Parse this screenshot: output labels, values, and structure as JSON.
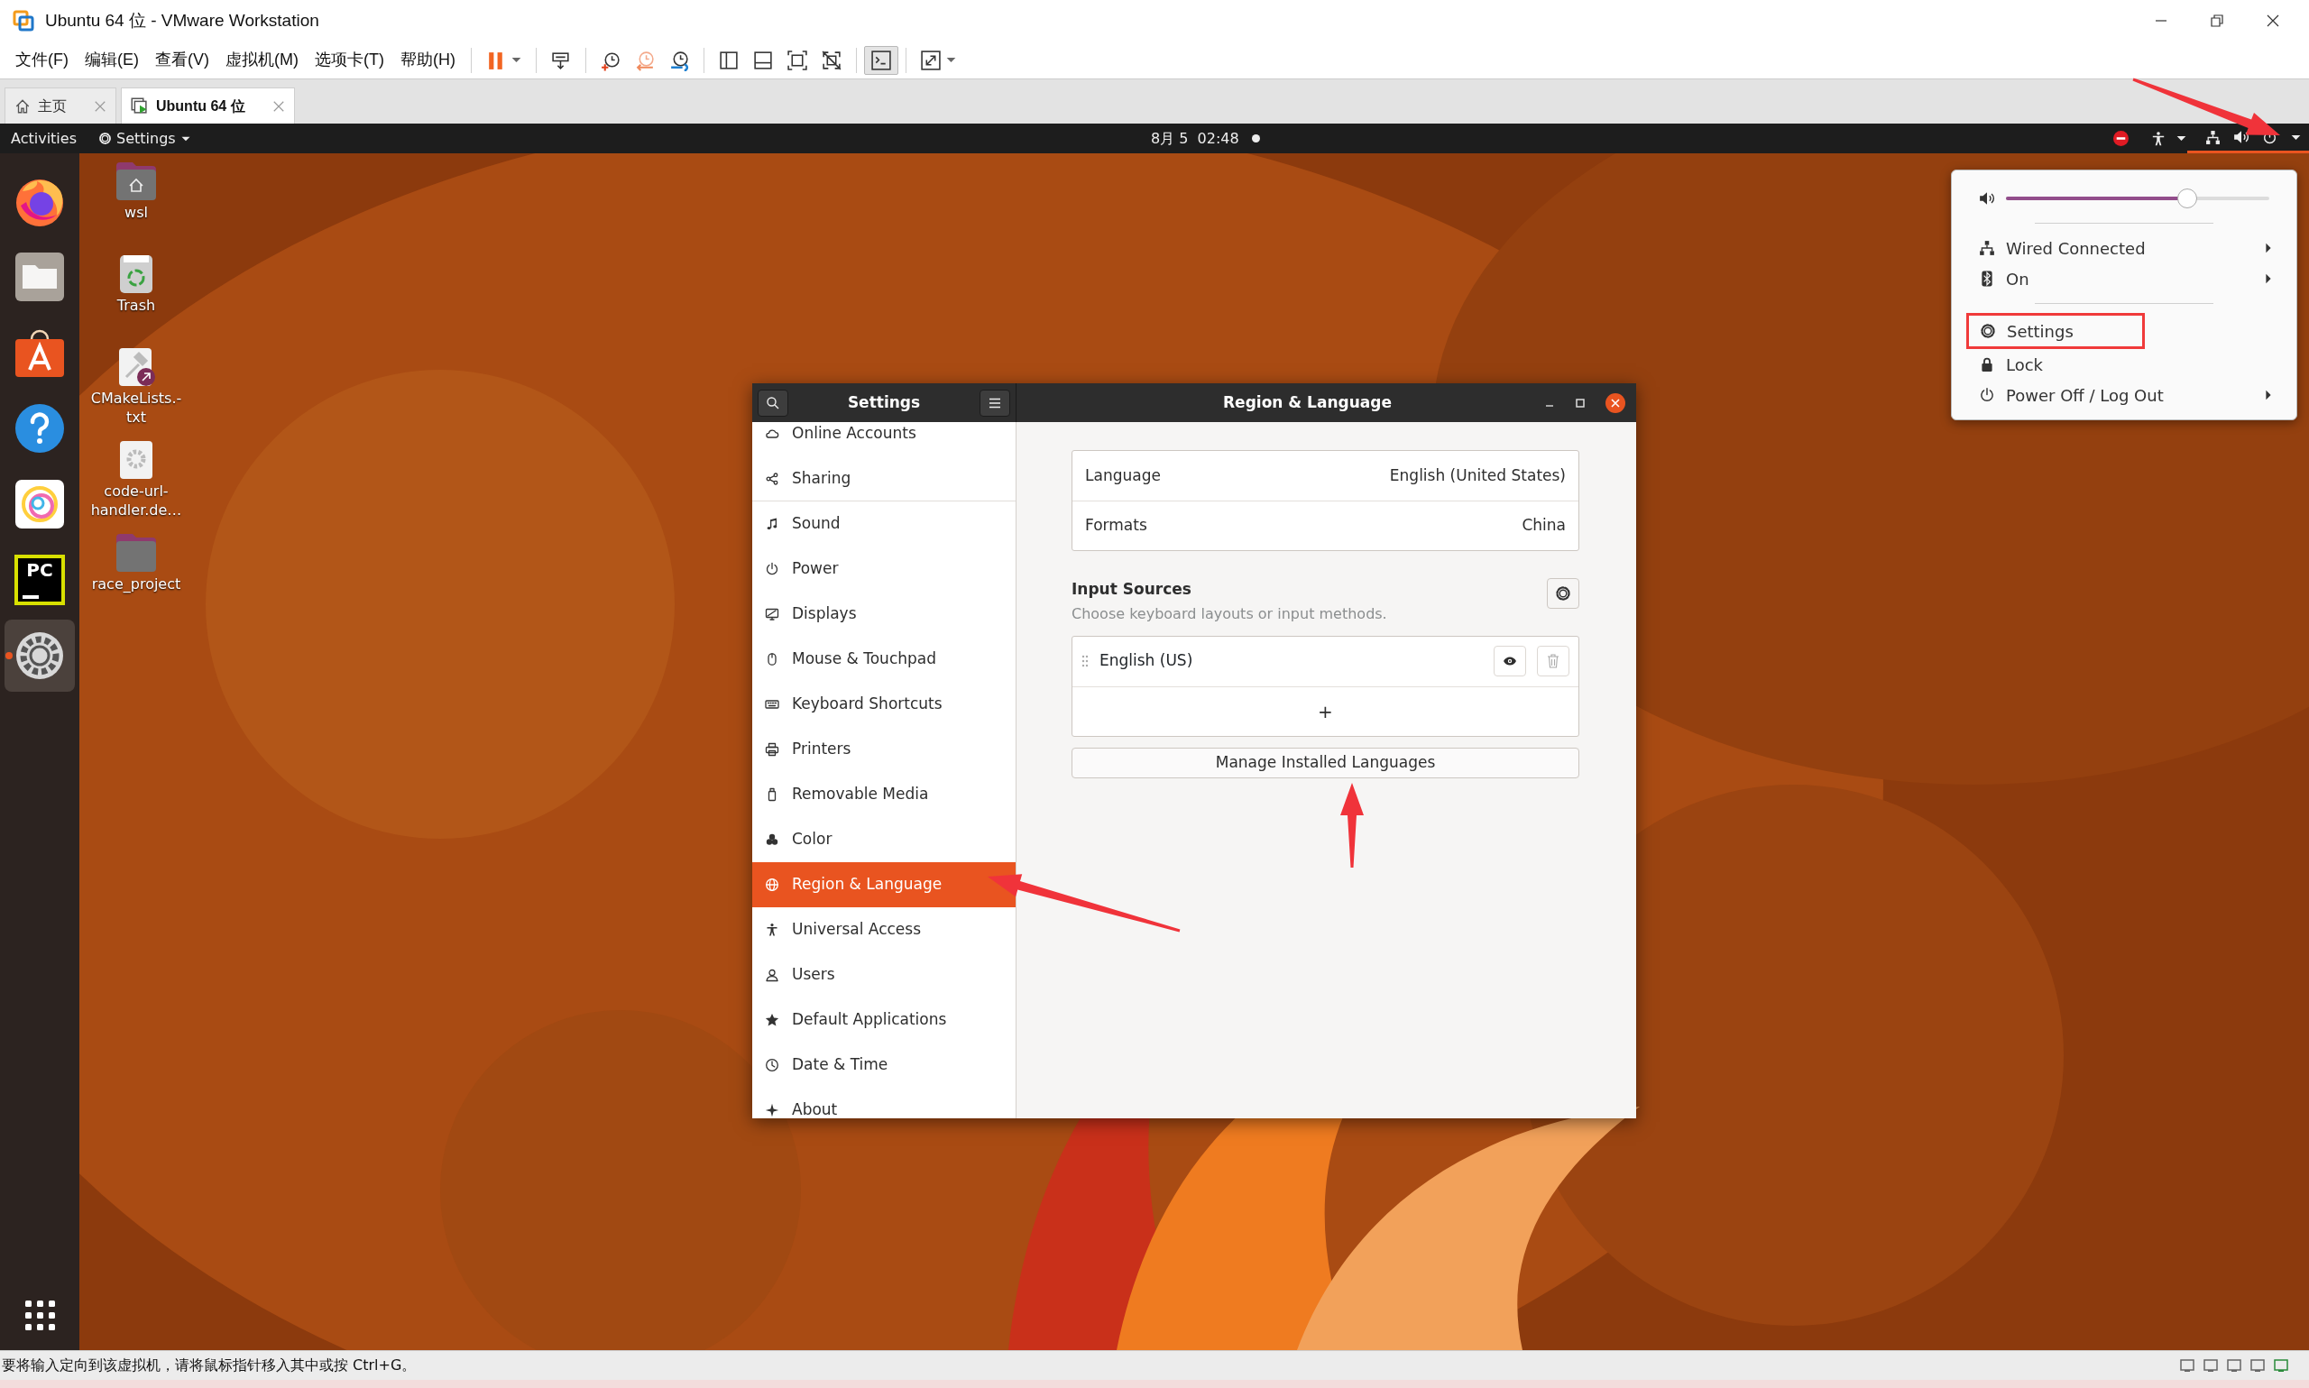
{
  "window": {
    "title": "Ubuntu 64 位 - VMware Workstation"
  },
  "menu": [
    "文件(F)",
    "编辑(E)",
    "查看(V)",
    "虚拟机(M)",
    "选项卡(T)",
    "帮助(H)"
  ],
  "toolbar": [
    {
      "kind": "pause",
      "caret": true,
      "pressed": false
    },
    {
      "kind": "separator"
    },
    {
      "kind": "send-keys",
      "caret": false,
      "pressed": false
    },
    {
      "kind": "separator"
    },
    {
      "kind": "snapshot-take",
      "caret": false,
      "pressed": false
    },
    {
      "kind": "snapshot-revert",
      "caret": false,
      "pressed": false
    },
    {
      "kind": "snapshot-manage",
      "caret": false,
      "pressed": false
    },
    {
      "kind": "separator"
    },
    {
      "kind": "view-library",
      "caret": false,
      "pressed": false
    },
    {
      "kind": "view-thumbs",
      "caret": false,
      "pressed": false
    },
    {
      "kind": "view-full",
      "caret": false,
      "pressed": false
    },
    {
      "kind": "view-unity",
      "caret": false,
      "pressed": false
    },
    {
      "kind": "separator"
    },
    {
      "kind": "console",
      "caret": false,
      "pressed": true
    },
    {
      "kind": "separator"
    },
    {
      "kind": "stretch",
      "caret": true,
      "pressed": false
    }
  ],
  "vm_tabs": [
    {
      "kind": "home",
      "label": "主页",
      "selected": false
    },
    {
      "kind": "vm",
      "label": "Ubuntu 64 位",
      "selected": true
    }
  ],
  "top_bar": {
    "activities": "Activities",
    "app_menu": "Settings",
    "clock": "8月 5  02:48",
    "notification_dot": true,
    "system_menu_open": true
  },
  "dock": [
    {
      "kind": "firefox",
      "running": false
    },
    {
      "kind": "files",
      "running": false
    },
    {
      "kind": "software",
      "running": false
    },
    {
      "kind": "help",
      "running": false
    },
    {
      "kind": "paint",
      "running": false
    },
    {
      "kind": "pycharm",
      "text": "PC",
      "running": false
    },
    {
      "kind": "settings",
      "running": true
    }
  ],
  "desktop_icons": [
    {
      "kind": "home-folder",
      "label": "wsl"
    },
    {
      "kind": "trash",
      "label": "Trash"
    },
    {
      "kind": "script-link",
      "label": "CMakeLists.-txt"
    },
    {
      "kind": "config",
      "label": "code-url-handler.de…"
    },
    {
      "kind": "folder",
      "label": "race_project"
    }
  ],
  "settings_window": {
    "sidebar_title": "Settings",
    "title": "Region & Language",
    "sidebar": [
      {
        "kind": "cloud",
        "label": "Online Accounts",
        "selected": false
      },
      {
        "kind": "share",
        "label": "Sharing",
        "selected": false
      },
      {
        "kind": "note",
        "label": "Sound",
        "selected": false
      },
      {
        "kind": "power",
        "label": "Power",
        "selected": false
      },
      {
        "kind": "display",
        "label": "Displays",
        "selected": false
      },
      {
        "kind": "mouse",
        "label": "Mouse & Touchpad",
        "selected": false
      },
      {
        "kind": "keyboard",
        "label": "Keyboard Shortcuts",
        "selected": false
      },
      {
        "kind": "printer",
        "label": "Printers",
        "selected": false
      },
      {
        "kind": "media",
        "label": "Removable Media",
        "selected": false
      },
      {
        "kind": "color",
        "label": "Color",
        "selected": false
      },
      {
        "kind": "globe",
        "label": "Region & Language",
        "selected": true
      },
      {
        "kind": "access",
        "label": "Universal Access",
        "selected": false
      },
      {
        "kind": "users",
        "label": "Users",
        "selected": false
      },
      {
        "kind": "star",
        "label": "Default Applications",
        "selected": false
      },
      {
        "kind": "clock",
        "label": "Date & Time",
        "selected": false
      },
      {
        "kind": "sparkle",
        "label": "About",
        "selected": false
      }
    ],
    "settings_rows": [
      {
        "label": "Language",
        "value": "English (United States)"
      },
      {
        "label": "Formats",
        "value": "China"
      }
    ],
    "input_sources": {
      "title": "Input Sources",
      "subtitle": "Choose keyboard layouts or input methods.",
      "sources": [
        {
          "label": "English (US)"
        }
      ],
      "add": "+",
      "manage_button": "Manage Installed Languages"
    }
  },
  "system_menu": {
    "volume": {
      "level": 0.69
    },
    "items": [
      {
        "kind": "network",
        "label": "Wired Connected",
        "submenu": true,
        "highlighted": false
      },
      {
        "kind": "bluetooth",
        "label": "On",
        "submenu": true,
        "highlighted": false
      },
      {
        "kind": "separator"
      },
      {
        "kind": "gear",
        "label": "Settings",
        "submenu": false,
        "highlighted": true
      },
      {
        "kind": "lock",
        "label": "Lock",
        "submenu": false,
        "highlighted": false
      },
      {
        "kind": "power",
        "label": "Power Off / Log Out",
        "submenu": true,
        "highlighted": false
      }
    ]
  },
  "status_bar": {
    "message": "要将输入定向到该虚拟机，请将鼠标指针移入其中或按 Ctrl+G。"
  }
}
